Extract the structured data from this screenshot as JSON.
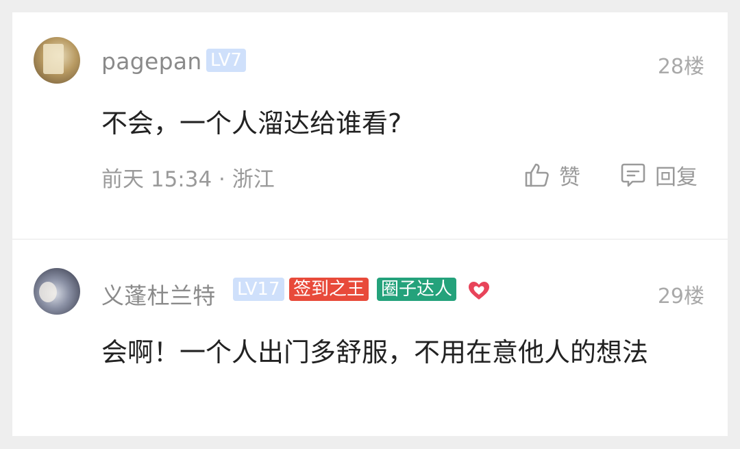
{
  "comments": [
    {
      "username": "pagepan",
      "level": "LV7",
      "floor": "28楼",
      "content": "不会，一个人溜达给谁看?",
      "meta": "前天 15:34 · 浙江",
      "like_label": "赞",
      "reply_label": "回复"
    },
    {
      "username": "义蓬杜兰特",
      "level": "LV17",
      "badges": [
        "签到之王",
        "圈子达人"
      ],
      "floor": "29楼",
      "content": "会啊！一个人出门多舒服，不用在意他人的想法"
    }
  ],
  "colors": {
    "level_badge": "#cfe0fb",
    "sign_badge": "#e84a3a",
    "circle_badge": "#24a27b",
    "heart": "#e8445a"
  },
  "icons": [
    "thumbs-up-icon",
    "comment-icon",
    "heart-icon"
  ]
}
